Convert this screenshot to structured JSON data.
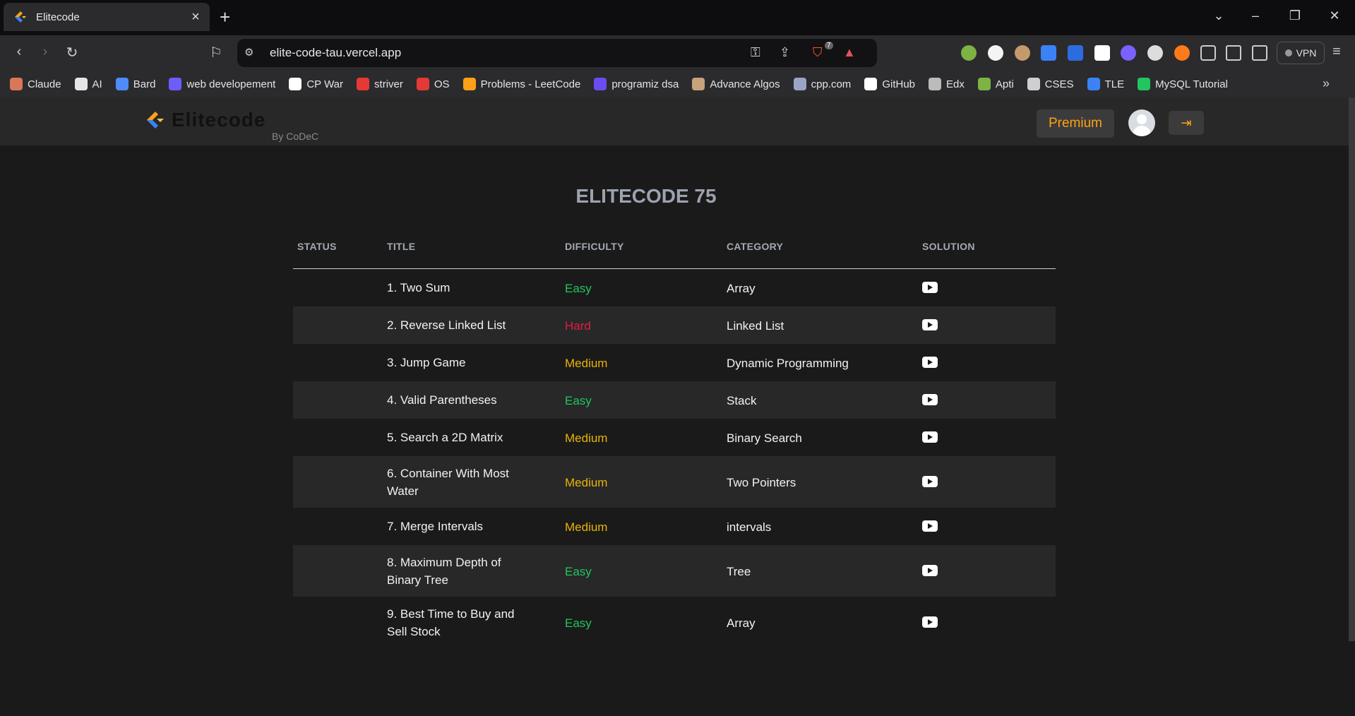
{
  "browser": {
    "tab_title": "Elitecode",
    "url": "elite-code-tau.vercel.app",
    "vpn_label": "VPN",
    "shield_badge": "7",
    "bookmarks": [
      {
        "label": "Claude",
        "color": "#d97757"
      },
      {
        "label": "AI",
        "color": "#e5e5e5"
      },
      {
        "label": "Bard",
        "color": "#4f8bf9"
      },
      {
        "label": "web developement",
        "color": "#6d5dfc"
      },
      {
        "label": "CP War",
        "color": "#ffffff"
      },
      {
        "label": "striver",
        "color": "#e53935"
      },
      {
        "label": "OS",
        "color": "#e53935"
      },
      {
        "label": "Problems - LeetCode",
        "color": "#ffa116"
      },
      {
        "label": "programiz dsa",
        "color": "#6c4cf1"
      },
      {
        "label": "Advance Algos",
        "color": "#c8a27a"
      },
      {
        "label": "cpp.com",
        "color": "#9aa4c7"
      },
      {
        "label": "GitHub",
        "color": "#ffffff"
      },
      {
        "label": "Edx",
        "color": "#bbbbbb"
      },
      {
        "label": "Apti",
        "color": "#7cb342"
      },
      {
        "label": "CSES",
        "color": "#cfcfcf"
      },
      {
        "label": "TLE",
        "color": "#3b82f6"
      },
      {
        "label": "MySQL Tutorial",
        "color": "#22c55e"
      }
    ]
  },
  "header": {
    "logo_text": "Elitecode",
    "byline": "By CoDeC",
    "premium_label": "Premium"
  },
  "main": {
    "heading": "ELITECODE 75",
    "columns": [
      "STATUS",
      "TITLE",
      "DIFFICULTY",
      "CATEGORY",
      "SOLUTION"
    ],
    "rows": [
      {
        "title": "1. Two Sum",
        "difficulty": "Easy",
        "category": "Array"
      },
      {
        "title": "2. Reverse Linked List",
        "difficulty": "Hard",
        "category": "Linked List"
      },
      {
        "title": "3. Jump Game",
        "difficulty": "Medium",
        "category": "Dynamic Programming"
      },
      {
        "title": "4. Valid Parentheses",
        "difficulty": "Easy",
        "category": "Stack"
      },
      {
        "title": "5. Search a 2D Matrix",
        "difficulty": "Medium",
        "category": "Binary Search"
      },
      {
        "title": "6. Container With Most Water",
        "difficulty": "Medium",
        "category": "Two Pointers"
      },
      {
        "title": "7. Merge Intervals",
        "difficulty": "Medium",
        "category": "intervals"
      },
      {
        "title": "8. Maximum Depth of Binary Tree",
        "difficulty": "Easy",
        "category": "Tree"
      },
      {
        "title": "9. Best Time to Buy and Sell Stock",
        "difficulty": "Easy",
        "category": "Array"
      }
    ]
  },
  "colors": {
    "accent": "#ffa116",
    "easy": "#22c55e",
    "medium": "#eab308",
    "hard": "#e11d48"
  }
}
